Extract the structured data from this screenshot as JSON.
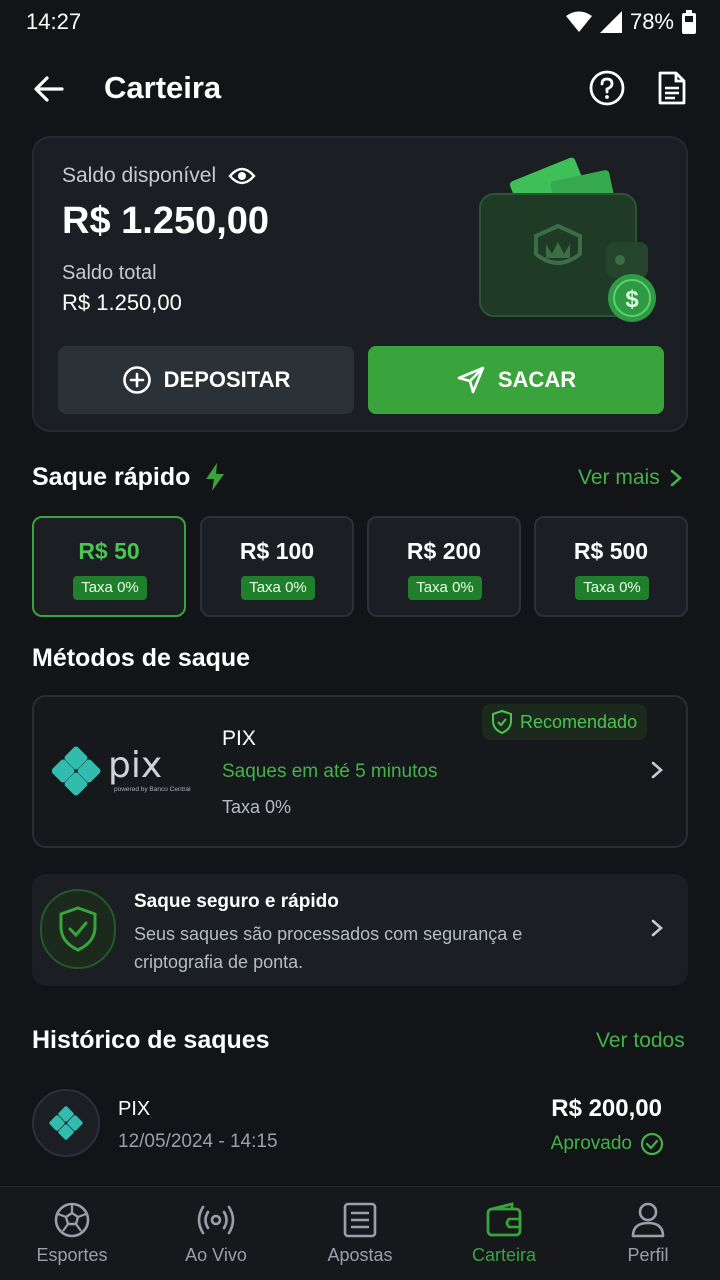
{
  "status_bar": {
    "time": "14:27",
    "battery": "78%"
  },
  "header": {
    "title": "Carteira"
  },
  "balance": {
    "available_label": "Saldo disponível",
    "available_value": "R$ 1.250,00",
    "total_label": "Saldo total",
    "total_value": "R$ 1.250,00",
    "deposit_label": "DEPOSITAR",
    "withdraw_label": "SACAR"
  },
  "quick_withdraw": {
    "title": "Saque rápido",
    "see_more": "Ver mais",
    "options": [
      {
        "amount": "R$ 50",
        "fee": "Taxa 0%",
        "selected": true
      },
      {
        "amount": "R$ 100",
        "fee": "Taxa 0%",
        "selected": false
      },
      {
        "amount": "R$ 200",
        "fee": "Taxa 0%",
        "selected": false
      },
      {
        "amount": "R$ 500",
        "fee": "Taxa 0%",
        "selected": false
      }
    ]
  },
  "methods": {
    "title": "Métodos de saque",
    "pix": {
      "logo_text": "pix",
      "logo_tagline": "powered by Banco Central",
      "name": "PIX",
      "speed": "Saques em até 5 minutos",
      "fee": "Taxa 0%",
      "badge": "Recomendado"
    }
  },
  "secure": {
    "title": "Saque seguro e rápido",
    "description": "Seus saques são processados com segurança e criptografia de ponta."
  },
  "history": {
    "title": "Histórico de saques",
    "see_all": "Ver todos",
    "items": [
      {
        "method": "PIX",
        "date": "12/05/2024 - 14:15",
        "amount": "R$ 200,00",
        "status": "Aprovado"
      }
    ]
  },
  "nav": {
    "items": [
      {
        "label": "Esportes",
        "icon": "soccer-ball-icon"
      },
      {
        "label": "Ao Vivo",
        "icon": "live-broadcast-icon"
      },
      {
        "label": "Apostas",
        "icon": "bet-slip-icon"
      },
      {
        "label": "Carteira",
        "icon": "wallet-icon",
        "active": true
      },
      {
        "label": "Perfil",
        "icon": "user-icon"
      }
    ]
  },
  "colors": {
    "accent": "#3aa43c",
    "background": "#121417",
    "card": "#1b1e22"
  }
}
